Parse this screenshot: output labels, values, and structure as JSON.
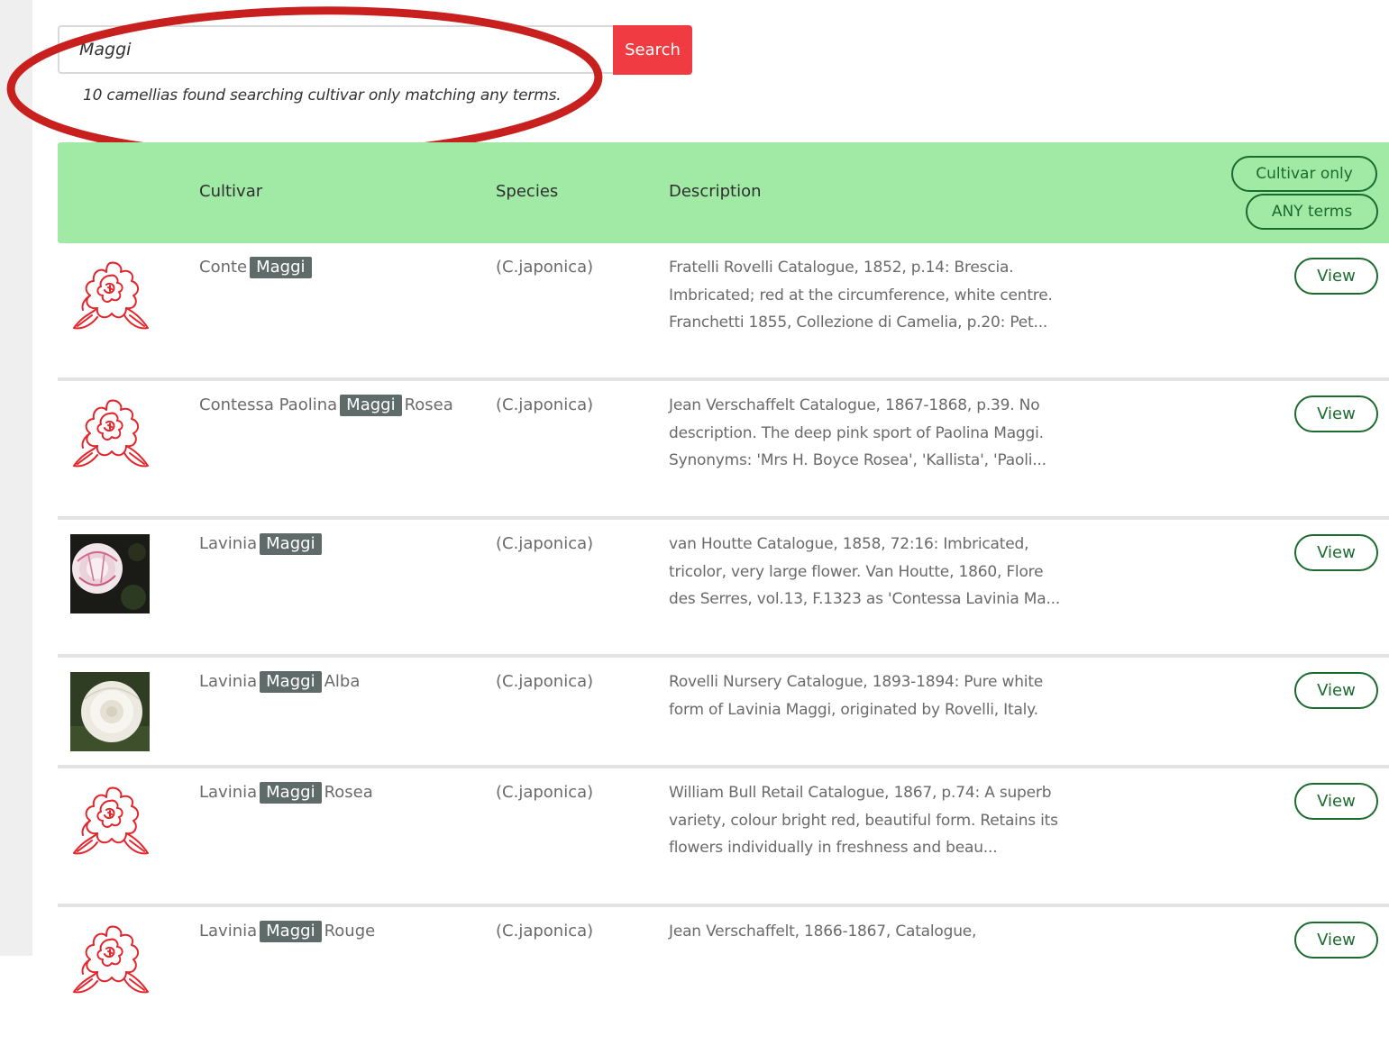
{
  "search": {
    "value": "Maggi",
    "button_label": "Search",
    "result_text": "10 camellias found searching cultivar only matching any terms."
  },
  "table": {
    "headers": {
      "cultivar": "Cultivar",
      "species": "Species",
      "description": "Description"
    },
    "filters": {
      "cultivar_only": "Cultivar only",
      "any_terms": "ANY terms"
    },
    "view_label": "View",
    "rows": [
      {
        "name_before": "Conte",
        "name_highlight": "Maggi",
        "name_after": "",
        "species": "(C.japonica)",
        "description": "Fratelli Rovelli Catalogue, 1852, p.14: Brescia. Imbricated; red at the circumference, white centre. Franchetti 1855, Collezione di Camelia, p.20: Pet...",
        "image": "camellia-outline-icon"
      },
      {
        "name_before": "Contessa Paolina",
        "name_highlight": "Maggi",
        "name_after": "Rosea",
        "species": "(C.japonica)",
        "description": "Jean Verschaffelt Catalogue, 1867-1868, p.39. No description. The deep pink sport of Paolina Maggi. Synonyms: 'Mrs H. Boyce Rosea', 'Kallista', 'Paoli...",
        "image": "camellia-outline-icon"
      },
      {
        "name_before": "Lavinia",
        "name_highlight": "Maggi",
        "name_after": "",
        "species": "(C.japonica)",
        "description": "van Houtte Catalogue, 1858, 72:16: Imbricated, tricolor, very large flower. Van Houtte, 1860, Flore des Serres, vol.13, F.1323 as 'Contessa Lavinia Ma...",
        "image": "striped-camellia-photo"
      },
      {
        "name_before": "Lavinia",
        "name_highlight": "Maggi",
        "name_after": "Alba",
        "species": "(C.japonica)",
        "description": "Rovelli Nursery Catalogue, 1893-1894: Pure white form of Lavinia Maggi, originated by Rovelli, Italy.",
        "image": "white-camellia-photo"
      },
      {
        "name_before": "Lavinia",
        "name_highlight": "Maggi",
        "name_after": "Rosea",
        "species": "(C.japonica)",
        "description": "William Bull Retail Catalogue, 1867, p.74: A superb variety, colour bright red, beautiful form. Retains its flowers individually in freshness and beau...",
        "image": "camellia-outline-icon"
      },
      {
        "name_before": "Lavinia",
        "name_highlight": "Maggi",
        "name_after": "Rouge",
        "species": "(C.japonica)",
        "description": "Jean Verschaffelt, 1866-1867, Catalogue,",
        "image": "camellia-outline-icon"
      }
    ]
  },
  "colors": {
    "search_button": "#ef3b41",
    "header_bg": "#a0eaa5",
    "accent_green": "#1b6b2e",
    "highlight_bg": "#5f6b69",
    "annotation_red": "#c8201e"
  }
}
